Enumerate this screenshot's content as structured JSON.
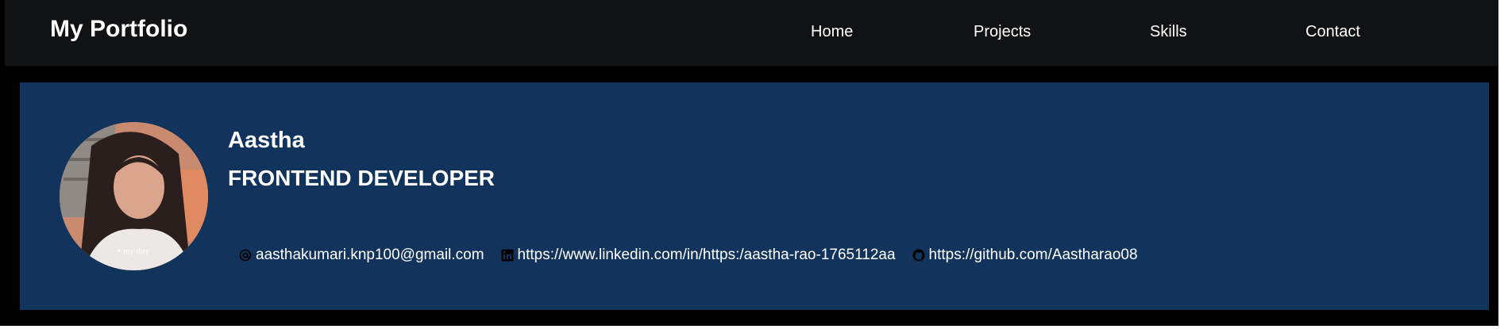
{
  "navbar": {
    "brand": "My Portfolio",
    "items": [
      {
        "label": "Home"
      },
      {
        "label": "Projects"
      },
      {
        "label": "Skills"
      },
      {
        "label": "Contact"
      }
    ]
  },
  "profile": {
    "name": "Aastha",
    "role": "FRONTEND DEVELOPER",
    "avatar_caption": "• my day",
    "contacts": [
      {
        "icon": "at-icon",
        "text": "aasthakumari.knp100@gmail.com"
      },
      {
        "icon": "linkedin-icon",
        "text": "https://www.linkedin.com/in/https:/aastha-rao-1765112aa"
      },
      {
        "icon": "github-icon",
        "text": "https://github.com/Aastharao08"
      }
    ]
  },
  "colors": {
    "navbar_bg": "#111213",
    "page_frame": "#000000",
    "card_bg": "#12345c",
    "text": "#ffffff"
  }
}
